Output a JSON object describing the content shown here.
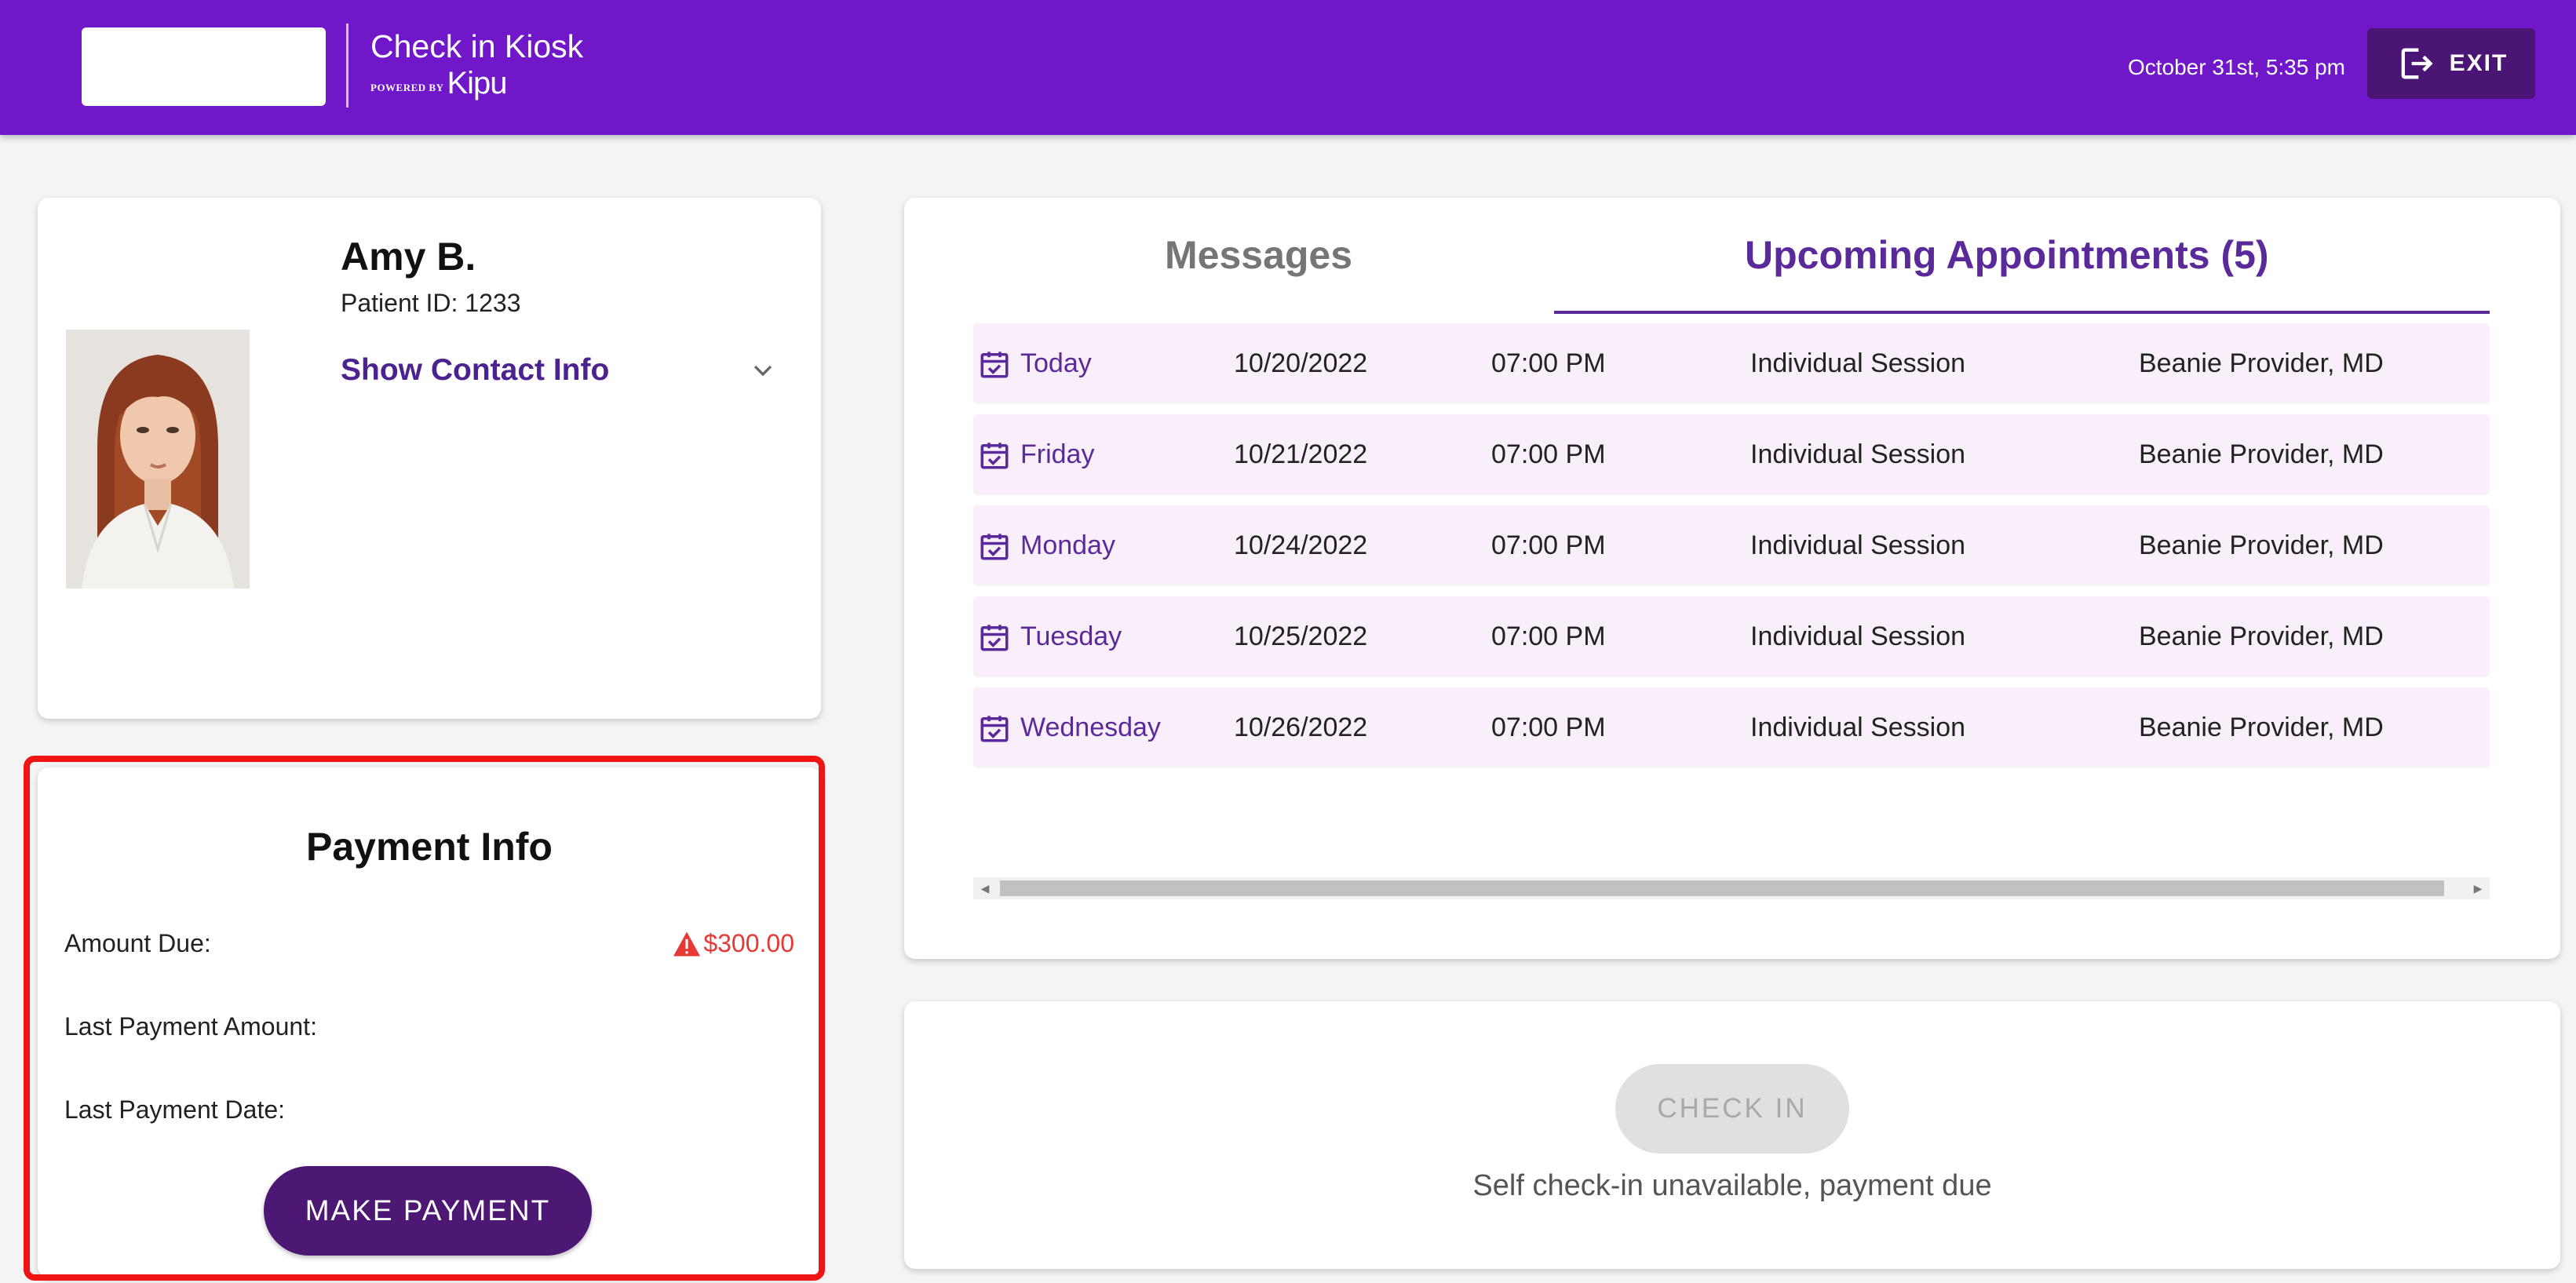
{
  "header": {
    "app_title": "Check in Kiosk",
    "powered_by_label": "POWERED BY",
    "powered_by_brand": "Kipu",
    "datetime": "October 31st, 5:35 pm",
    "exit_label": "EXIT",
    "background_color": "#6f17c9"
  },
  "patient": {
    "name": "Amy B.",
    "patient_id": "Patient ID: 1233",
    "contact_toggle_label": "Show Contact Info"
  },
  "payment": {
    "title": "Payment Info",
    "amount_due_label": "Amount Due:",
    "amount_due_value": "$300.00",
    "last_payment_amount_label": "Last Payment Amount:",
    "last_payment_amount_value": "",
    "last_payment_date_label": "Last Payment Date:",
    "last_payment_date_value": "",
    "make_payment_label": "MAKE PAYMENT",
    "warning_color": "#e53935"
  },
  "tabs": {
    "messages_label": "Messages",
    "appointments_label": "Upcoming Appointments (5)",
    "active": "appointments"
  },
  "appointments": [
    {
      "day": "Today",
      "date": "10/20/2022",
      "time": "07:00 PM",
      "type": "Individual Session",
      "provider": "Beanie Provider, MD"
    },
    {
      "day": "Friday",
      "date": "10/21/2022",
      "time": "07:00 PM",
      "type": "Individual Session",
      "provider": "Beanie Provider, MD"
    },
    {
      "day": "Monday",
      "date": "10/24/2022",
      "time": "07:00 PM",
      "type": "Individual Session",
      "provider": "Beanie Provider, MD"
    },
    {
      "day": "Tuesday",
      "date": "10/25/2022",
      "time": "07:00 PM",
      "type": "Individual Session",
      "provider": "Beanie Provider, MD"
    },
    {
      "day": "Wednesday",
      "date": "10/26/2022",
      "time": "07:00 PM",
      "type": "Individual Session",
      "provider": "Beanie Provider, MD"
    }
  ],
  "checkin": {
    "button_label": "CHECK IN",
    "status_note": "Self check-in unavailable, payment due",
    "enabled": false
  },
  "icons": {
    "exit": "exit-icon",
    "chevron": "chevron-down-icon",
    "calendar": "calendar-check-icon",
    "warning": "warning-icon"
  }
}
